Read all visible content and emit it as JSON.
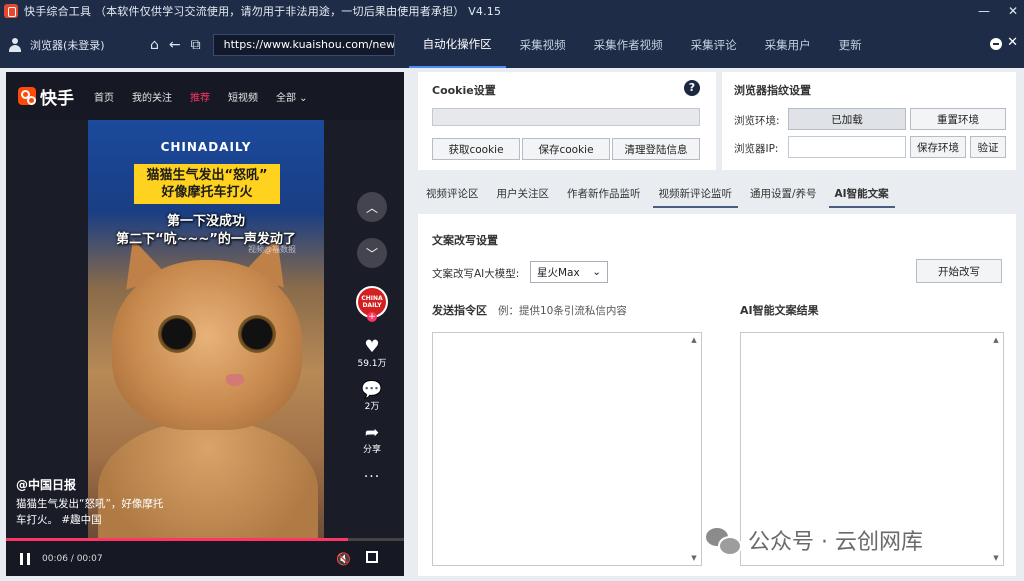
{
  "window": {
    "title": "快手综合工具 （本软件仅供学习交流使用，请勿用于非法用途，一切后果由使用者承担）  V4.15",
    "minimize_glyph": "—",
    "close_glyph": "✕"
  },
  "toolbar": {
    "user_label": "浏览器(未登录)",
    "url": "https://www.kuaishou.com/new-r",
    "tabs": [
      {
        "label": "自动化操作区",
        "active": true
      },
      {
        "label": "采集视频"
      },
      {
        "label": "采集作者视频"
      },
      {
        "label": "采集评论"
      },
      {
        "label": "采集用户"
      },
      {
        "label": "更新"
      }
    ],
    "close_glyph": "✕"
  },
  "browser": {
    "logo_text": "快手",
    "nav": [
      "首页",
      "我的关注",
      "推荐",
      "短视频",
      "全部 ⌄"
    ],
    "video": {
      "brand": "CHINADAILY",
      "headline_1": "猫猫生气发出“怒吼”",
      "headline_2": "好像摩托车打火",
      "subtitle_1": "第一下没成功",
      "subtitle_2": "第二下“吭~~~”的一声发动了",
      "watermark": "视频@福数报",
      "author": "@中国日报",
      "desc_1": "猫猫生气发出“怒吼”，好像摩托",
      "desc_2": "车打火。 #趣中国"
    },
    "side": {
      "avatar_text": "CHINA DAILY",
      "plus": "+",
      "likes": "59.1万",
      "comments": "2万",
      "share": "分享",
      "more": "···"
    },
    "player": {
      "time": "00:06 / 00:07",
      "progress": 0.86
    }
  },
  "cookie_panel": {
    "title": "Cookie设置",
    "help": "?",
    "buttons": [
      "获取cookie",
      "保存cookie",
      "清理登陆信息"
    ]
  },
  "fingerprint_panel": {
    "title": "浏览器指纹设置",
    "env_label": "浏览环境:",
    "env_status": "已加载",
    "reset_button": "重置环境",
    "ip_label": "浏览器IP:",
    "save_button": "保存环境",
    "verify_button": "验证"
  },
  "sub_tabs": [
    {
      "label": "视频评论区"
    },
    {
      "label": "用户关注区"
    },
    {
      "label": "作者新作品监听"
    },
    {
      "label": "视频新评论监听",
      "active": true
    },
    {
      "label": "通用设置/养号"
    },
    {
      "label": "AI智能文案",
      "active": true
    }
  ],
  "ai_panel": {
    "section_title": "文案改写设置",
    "model_label": "文案改写AI大模型:",
    "model_value": "星火Max",
    "start_button": "开始改写",
    "command_title": "发送指令区",
    "command_hint": "例：提供10条引流私信内容",
    "result_title": "AI智能文案结果"
  },
  "watermark_text": "公众号 · 云创网库"
}
